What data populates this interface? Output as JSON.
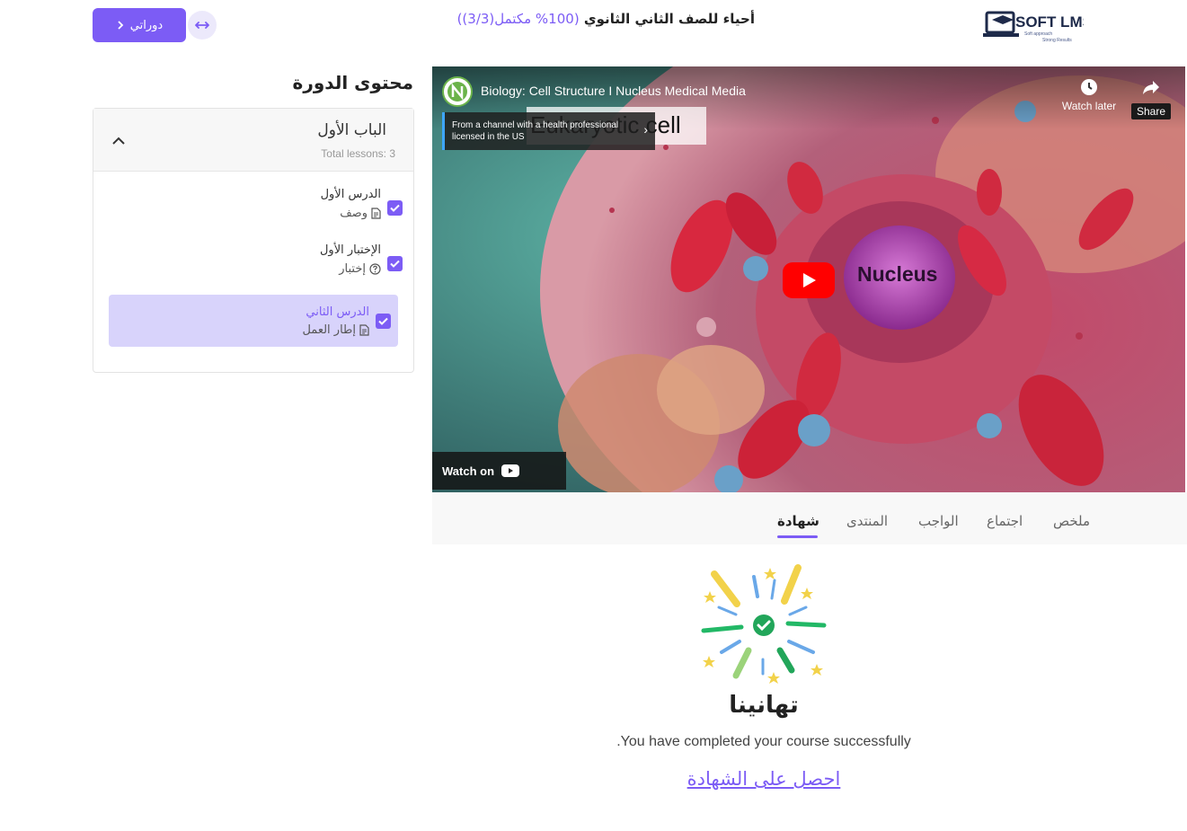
{
  "header": {
    "logo_text": "SOFT LMS",
    "logo_tagline": "Soft approach · Strong Results",
    "course_name": "أحياء للصف الثاني الثانوي",
    "progress_text": "(100% مكتمل(3/3))",
    "my_courses_label": "دوراتي",
    "accent_color": "#7c5cf5"
  },
  "sidebar": {
    "heading": "محتوى الدورة",
    "section": {
      "title": "الباب الأول",
      "total_lessons": "Total lessons: 3"
    },
    "lessons": [
      {
        "title": "الدرس الأول",
        "type_label": "وصف",
        "type_icon": "document-icon",
        "completed": true,
        "active": false
      },
      {
        "title": "الإختبار الأول",
        "type_label": "إختبار",
        "type_icon": "question-icon",
        "completed": true,
        "active": false
      },
      {
        "title": "الدرس الثاني",
        "type_label": "إطار العمل",
        "type_icon": "document-icon",
        "completed": true,
        "active": true
      }
    ]
  },
  "video": {
    "title": "Biology: Cell Structure I Nucleus Medical Media",
    "caption": "Eukaryotic cell",
    "info_banner": "From a channel with a health professional licensed in the US",
    "watch_later": "Watch later",
    "share": "Share",
    "watch_on": "Watch on",
    "youtube": "YouTube",
    "scene_label": "Nucleus"
  },
  "tabs": [
    {
      "label": "ملخص",
      "active": false
    },
    {
      "label": "اجتماع",
      "active": false
    },
    {
      "label": "الواجب",
      "active": false
    },
    {
      "label": "المنتدى",
      "active": false
    },
    {
      "label": "شهادة",
      "active": true
    }
  ],
  "certificate": {
    "title": "تهانينا",
    "message": "You have completed your course successfully.",
    "link_label": "احصل على الشهادة"
  }
}
